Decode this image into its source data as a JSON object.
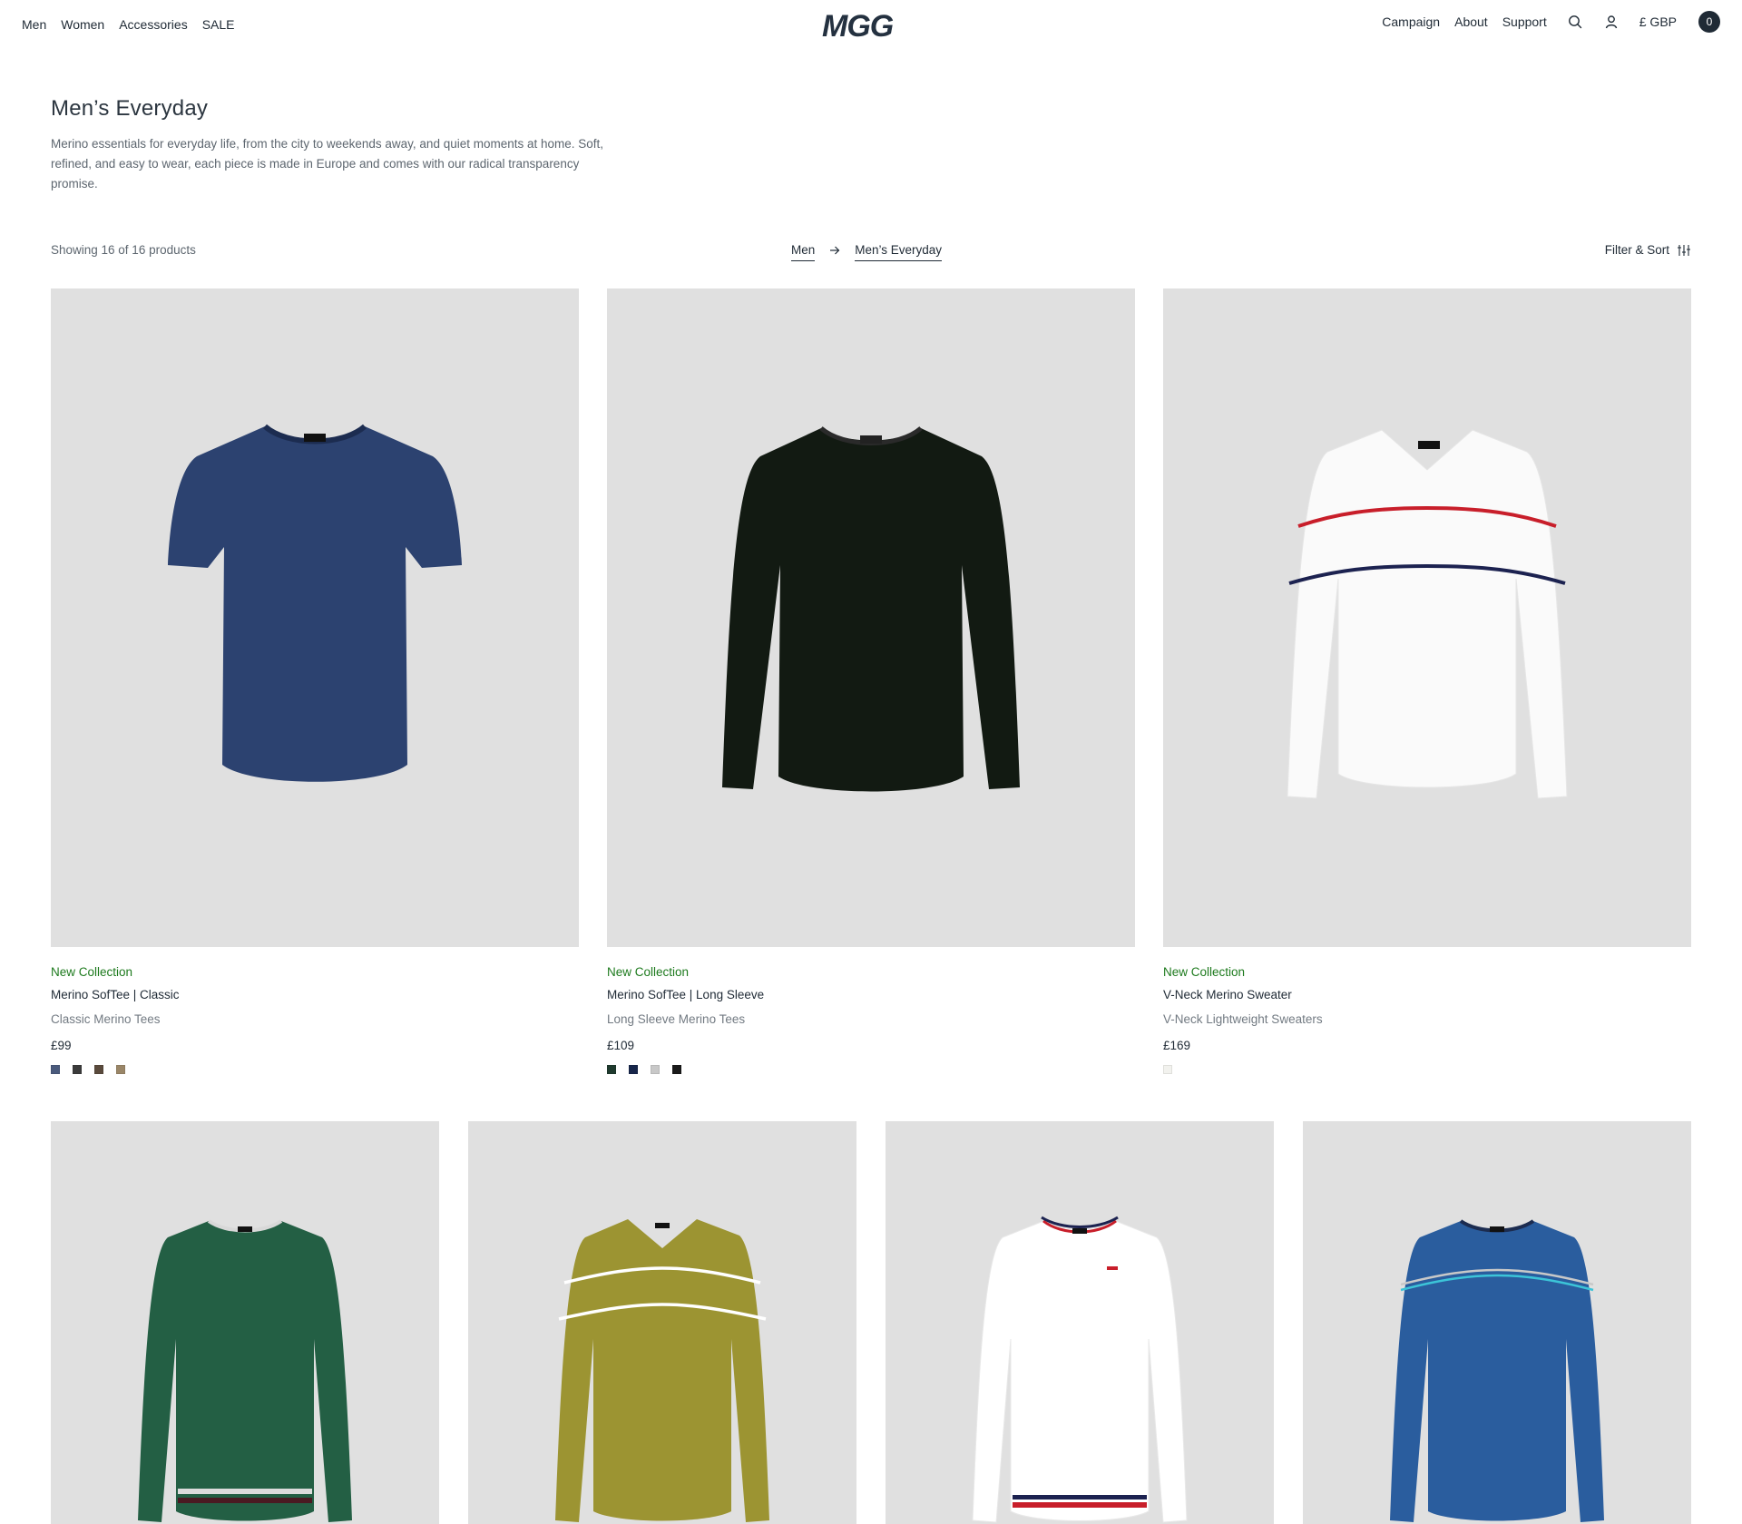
{
  "header": {
    "nav_left": [
      "Men",
      "Women",
      "Accessories",
      "SALE"
    ],
    "logo_text": "MGG",
    "nav_right": [
      "Campaign",
      "About",
      "Support"
    ],
    "currency": "£ GBP",
    "cart_count": "0",
    "icons": [
      "search-icon",
      "account-icon"
    ]
  },
  "intro": {
    "title": "Men’s Everyday",
    "description": "Merino essentials for everyday life, from the city to weekends away, and quiet moments at home. Soft, refined, and easy to wear, each piece is made in Europe and comes with our radical transparency promise."
  },
  "toolbar": {
    "showing": "Showing 16 of 16 products",
    "breadcrumb": [
      "Men",
      "Men’s Everyday"
    ],
    "filter_label": "Filter & Sort",
    "filter_icon": "sliders-icon"
  },
  "products_row1": [
    {
      "badge": "New Collection",
      "name": "Merino SofTee | Classic",
      "category": "Classic Merino Tees",
      "price": "£99",
      "garment_color": "#2c4270",
      "swatches": [
        "#4a5a7c",
        "#3b3b3b",
        "#5a4a3c",
        "#9a8668"
      ]
    },
    {
      "badge": "New Collection",
      "name": "Merino SofTee | Long Sleeve",
      "category": "Long Sleeve Merino Tees",
      "price": "£109",
      "garment_color": "#121a12",
      "swatches": [
        "#1f3a2e",
        "#17264a",
        "#c8c8c8",
        "#1a1a1a"
      ]
    },
    {
      "badge": "New Collection",
      "name": "V-Neck Merino Sweater",
      "category": "V-Neck Lightweight Sweaters",
      "price": "£169",
      "garment_color": "#fafafa",
      "swatches": [
        "#f2f2ee"
      ]
    }
  ],
  "products_row2": [
    {
      "garment_color": "#235f44"
    },
    {
      "garment_color": "#9c9432"
    },
    {
      "garment_color": "#ffffff"
    },
    {
      "garment_color": "#2a5d9e"
    }
  ]
}
